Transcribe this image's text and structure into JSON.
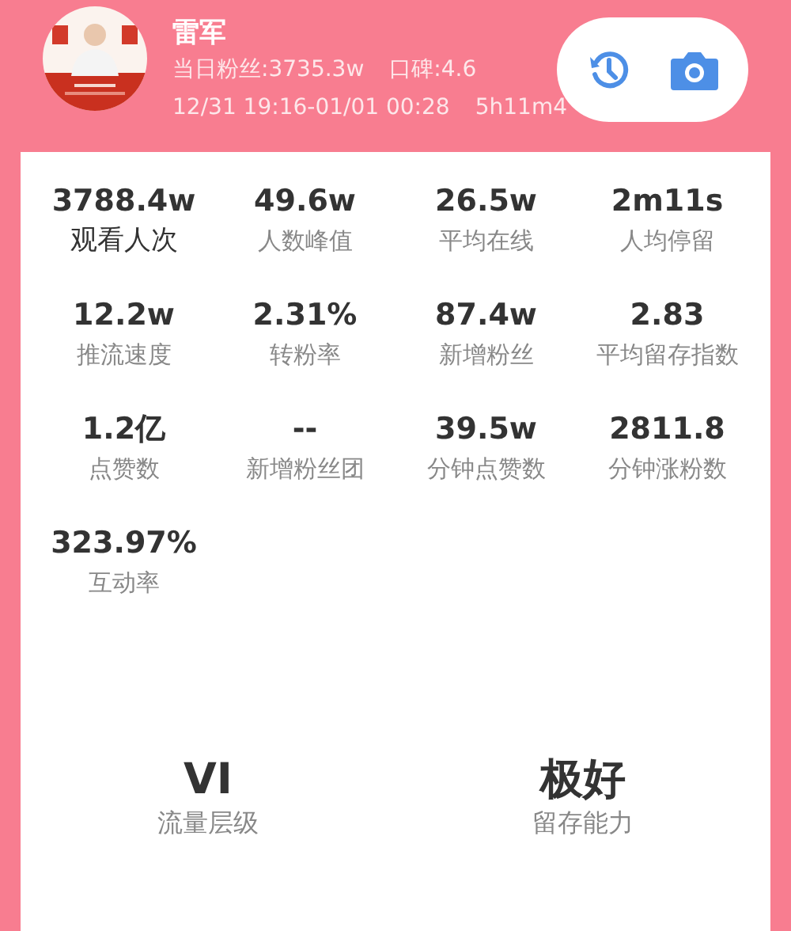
{
  "header": {
    "name": "雷军",
    "fans_line": "当日粉丝:3735.3w",
    "rating": "口碑:4.6",
    "time_range": "12/31 19:16-01/01 00:28",
    "duration": "5h11m4"
  },
  "metrics": [
    {
      "value": "3788.4w",
      "label": "观看人次",
      "selected": true
    },
    {
      "value": "49.6w",
      "label": "人数峰值",
      "selected": false
    },
    {
      "value": "26.5w",
      "label": "平均在线",
      "selected": false
    },
    {
      "value": "2m11s",
      "label": "人均停留",
      "selected": false
    },
    {
      "value": "12.2w",
      "label": "推流速度",
      "selected": false
    },
    {
      "value": "2.31%",
      "label": "转粉率",
      "selected": false
    },
    {
      "value": "87.4w",
      "label": "新增粉丝",
      "selected": false
    },
    {
      "value": "2.83",
      "label": "平均留存指数",
      "selected": false
    },
    {
      "value": "1.2亿",
      "label": "点赞数",
      "selected": false
    },
    {
      "value": "--",
      "label": "新增粉丝团",
      "selected": false
    },
    {
      "value": "39.5w",
      "label": "分钟点赞数",
      "selected": false
    },
    {
      "value": "2811.8",
      "label": "分钟涨粉数",
      "selected": false
    },
    {
      "value": "323.97%",
      "label": "互动率",
      "selected": false
    }
  ],
  "ratings": [
    {
      "value": "VI",
      "label": "流量层级"
    },
    {
      "value": "极好",
      "label": "留存能力"
    }
  ]
}
